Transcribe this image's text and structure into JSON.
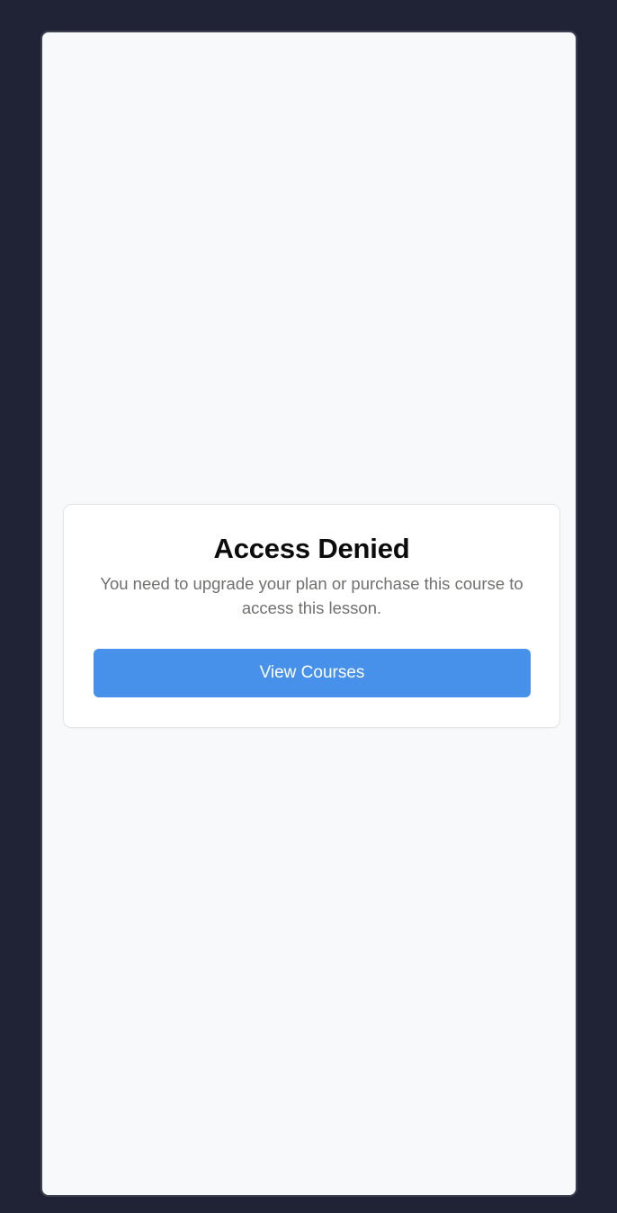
{
  "access_card": {
    "title": "Access Denied",
    "message": "You need to upgrade your plan or purchase this course to access this lesson.",
    "button_label": "View Courses"
  },
  "colors": {
    "background": "#1f2335",
    "screen": "#f8f9fb",
    "card": "#ffffff",
    "title": "#0c0c0c",
    "message": "#72706e",
    "button": "#4791ea",
    "button_text": "#ffffff"
  }
}
